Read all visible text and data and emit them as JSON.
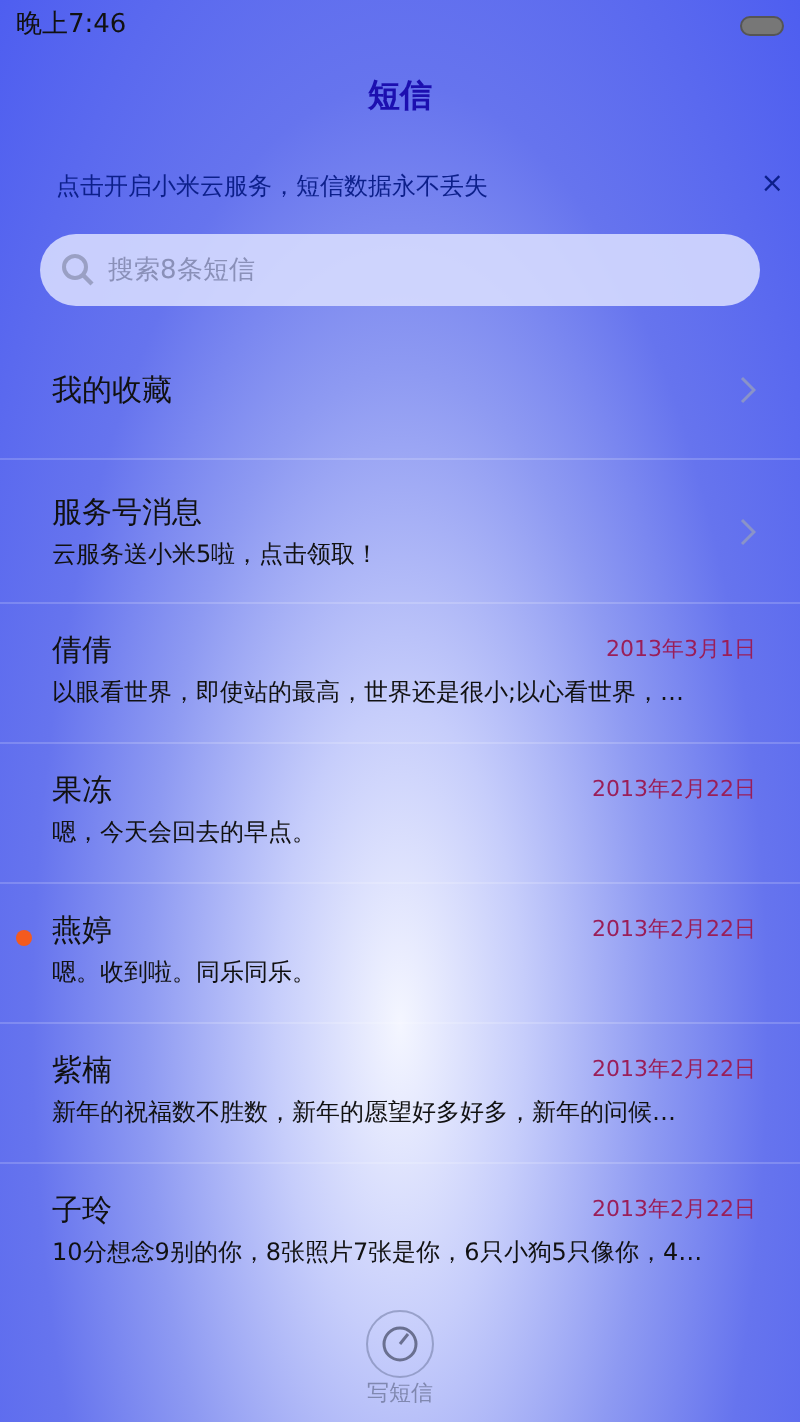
{
  "status_bar": {
    "time": "晚上7:46"
  },
  "title": "短信",
  "banner": {
    "text": "点击开启小米云服务，短信数据永不丢失",
    "close": "×"
  },
  "search": {
    "placeholder": "搜索8条短信"
  },
  "shortcuts": [
    {
      "title": "我的收藏"
    },
    {
      "title": "服务号消息",
      "subtitle": "云服务送小米5啦，点击领取！"
    }
  ],
  "conversations": [
    {
      "name": "倩倩",
      "date": "2013年3月1日",
      "preview": "以眼看世界，即使站的最高，世界还是很小;以心看世界，…",
      "unread": false
    },
    {
      "name": "果冻",
      "date": "2013年2月22日",
      "preview": "嗯，今天会回去的早点。",
      "unread": false
    },
    {
      "name": "燕婷",
      "date": "2013年2月22日",
      "preview": "嗯。收到啦。同乐同乐。",
      "unread": true
    },
    {
      "name": "紫楠",
      "date": "2013年2月22日",
      "preview": "新年的祝福数不胜数，新年的愿望好多好多，新年的问候…",
      "unread": false
    },
    {
      "name": "子玲",
      "date": "2013年2月22日",
      "preview": "10分想念9别的你，8张照片7张是你，6只小狗5只像你，4…",
      "unread": false
    }
  ],
  "compose": {
    "label": "写短信"
  }
}
